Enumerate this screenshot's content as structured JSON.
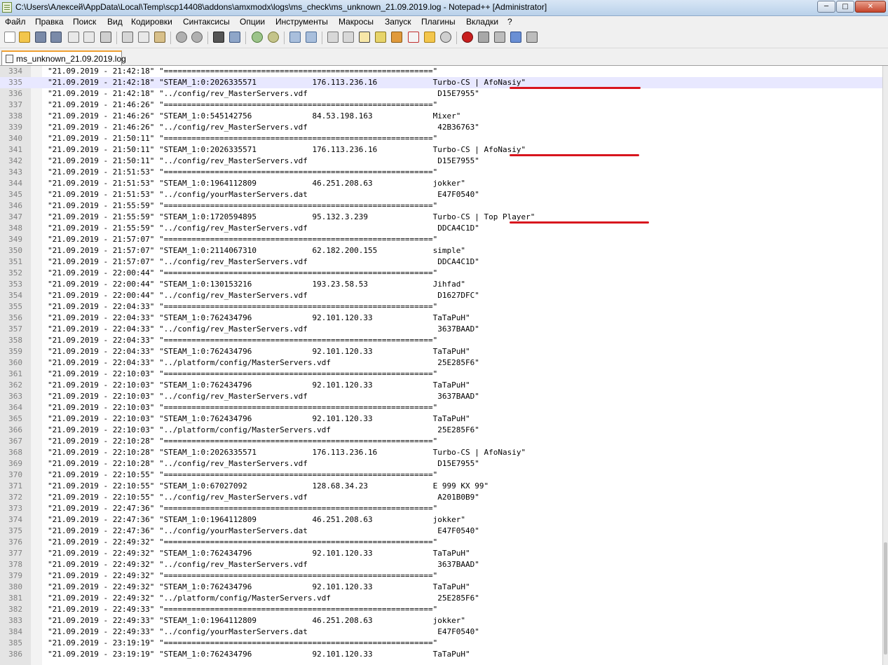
{
  "window": {
    "title": "C:\\Users\\Алексей\\AppData\\Local\\Temp\\scp14408\\addons\\amxmodx\\logs\\ms_check\\ms_unknown_21.09.2019.log - Notepad++ [Administrator]",
    "minimize_symbol": "─",
    "maximize_symbol": "□",
    "close_symbol": "✕"
  },
  "menu": {
    "items": [
      "Файл",
      "Правка",
      "Поиск",
      "Вид",
      "Кодировки",
      "Синтаксисы",
      "Опции",
      "Инструменты",
      "Макросы",
      "Запуск",
      "Плагины",
      "Вкладки",
      "?"
    ]
  },
  "tab": {
    "label": "ms_unknown_21.09.2019.log"
  },
  "editor": {
    "lines": [
      {
        "n": "334",
        "text": "\"21.09.2019 - 21:42:18\" \"==========================================================\""
      },
      {
        "n": "335",
        "text": "\"21.09.2019 - 21:42:18\" \"STEAM_1:0:2026335571            176.113.236.16            Turbo-CS | AfoNasiy\""
      },
      {
        "n": "336",
        "text": "\"21.09.2019 - 21:42:18\" \"../config/rev_MasterServers.vdf                            D15E7955\""
      },
      {
        "n": "337",
        "text": "\"21.09.2019 - 21:46:26\" \"==========================================================\""
      },
      {
        "n": "338",
        "text": "\"21.09.2019 - 21:46:26\" \"STEAM_1:0:545142756             84.53.198.163             Mixer\""
      },
      {
        "n": "339",
        "text": "\"21.09.2019 - 21:46:26\" \"../config/rev_MasterServers.vdf                            42B36763\""
      },
      {
        "n": "340",
        "text": "\"21.09.2019 - 21:50:11\" \"==========================================================\""
      },
      {
        "n": "341",
        "text": "\"21.09.2019 - 21:50:11\" \"STEAM_1:0:2026335571            176.113.236.16            Turbo-CS | AfoNasiy\""
      },
      {
        "n": "342",
        "text": "\"21.09.2019 - 21:50:11\" \"../config/rev_MasterServers.vdf                            D15E7955\""
      },
      {
        "n": "343",
        "text": "\"21.09.2019 - 21:51:53\" \"==========================================================\""
      },
      {
        "n": "344",
        "text": "\"21.09.2019 - 21:51:53\" \"STEAM_1:0:1964112809            46.251.208.63             jokker\""
      },
      {
        "n": "345",
        "text": "\"21.09.2019 - 21:51:53\" \"../config/yourMasterServers.dat                            E47F0540\""
      },
      {
        "n": "346",
        "text": "\"21.09.2019 - 21:55:59\" \"==========================================================\""
      },
      {
        "n": "347",
        "text": "\"21.09.2019 - 21:55:59\" \"STEAM_1:0:1720594895            95.132.3.239              Turbo-CS | Top Player\""
      },
      {
        "n": "348",
        "text": "\"21.09.2019 - 21:55:59\" \"../config/rev_MasterServers.vdf                            DDCA4C1D\""
      },
      {
        "n": "349",
        "text": "\"21.09.2019 - 21:57:07\" \"==========================================================\""
      },
      {
        "n": "350",
        "text": "\"21.09.2019 - 21:57:07\" \"STEAM_1:0:2114067310            62.182.200.155            simple\""
      },
      {
        "n": "351",
        "text": "\"21.09.2019 - 21:57:07\" \"../config/rev_MasterServers.vdf                            DDCA4C1D\""
      },
      {
        "n": "352",
        "text": "\"21.09.2019 - 22:00:44\" \"==========================================================\""
      },
      {
        "n": "353",
        "text": "\"21.09.2019 - 22:00:44\" \"STEAM_1:0:130153216             193.23.58.53              Jihfad\""
      },
      {
        "n": "354",
        "text": "\"21.09.2019 - 22:00:44\" \"../config/rev_MasterServers.vdf                            D1627DFC\""
      },
      {
        "n": "355",
        "text": "\"21.09.2019 - 22:04:33\" \"==========================================================\""
      },
      {
        "n": "356",
        "text": "\"21.09.2019 - 22:04:33\" \"STEAM_1:0:762434796             92.101.120.33             TaTaPuH\""
      },
      {
        "n": "357",
        "text": "\"21.09.2019 - 22:04:33\" \"../config/rev_MasterServers.vdf                            3637BAAD\""
      },
      {
        "n": "358",
        "text": "\"21.09.2019 - 22:04:33\" \"==========================================================\""
      },
      {
        "n": "359",
        "text": "\"21.09.2019 - 22:04:33\" \"STEAM_1:0:762434796             92.101.120.33             TaTaPuH\""
      },
      {
        "n": "360",
        "text": "\"21.09.2019 - 22:04:33\" \"../platform/config/MasterServers.vdf                       25E285F6\""
      },
      {
        "n": "361",
        "text": "\"21.09.2019 - 22:10:03\" \"==========================================================\""
      },
      {
        "n": "362",
        "text": "\"21.09.2019 - 22:10:03\" \"STEAM_1:0:762434796             92.101.120.33             TaTaPuH\""
      },
      {
        "n": "363",
        "text": "\"21.09.2019 - 22:10:03\" \"../config/rev_MasterServers.vdf                            3637BAAD\""
      },
      {
        "n": "364",
        "text": "\"21.09.2019 - 22:10:03\" \"==========================================================\""
      },
      {
        "n": "365",
        "text": "\"21.09.2019 - 22:10:03\" \"STEAM_1:0:762434796             92.101.120.33             TaTaPuH\""
      },
      {
        "n": "366",
        "text": "\"21.09.2019 - 22:10:03\" \"../platform/config/MasterServers.vdf                       25E285F6\""
      },
      {
        "n": "367",
        "text": "\"21.09.2019 - 22:10:28\" \"==========================================================\""
      },
      {
        "n": "368",
        "text": "\"21.09.2019 - 22:10:28\" \"STEAM_1:0:2026335571            176.113.236.16            Turbo-CS | AfoNasiy\""
      },
      {
        "n": "369",
        "text": "\"21.09.2019 - 22:10:28\" \"../config/rev_MasterServers.vdf                            D15E7955\""
      },
      {
        "n": "370",
        "text": "\"21.09.2019 - 22:10:55\" \"==========================================================\""
      },
      {
        "n": "371",
        "text": "\"21.09.2019 - 22:10:55\" \"STEAM_1:0:67027092              128.68.34.23              E 999 KX 99\""
      },
      {
        "n": "372",
        "text": "\"21.09.2019 - 22:10:55\" \"../config/rev_MasterServers.vdf                            A201B0B9\""
      },
      {
        "n": "373",
        "text": "\"21.09.2019 - 22:47:36\" \"==========================================================\""
      },
      {
        "n": "374",
        "text": "\"21.09.2019 - 22:47:36\" \"STEAM_1:0:1964112809            46.251.208.63             jokker\""
      },
      {
        "n": "375",
        "text": "\"21.09.2019 - 22:47:36\" \"../config/yourMasterServers.dat                            E47F0540\""
      },
      {
        "n": "376",
        "text": "\"21.09.2019 - 22:49:32\" \"==========================================================\""
      },
      {
        "n": "377",
        "text": "\"21.09.2019 - 22:49:32\" \"STEAM_1:0:762434796             92.101.120.33             TaTaPuH\""
      },
      {
        "n": "378",
        "text": "\"21.09.2019 - 22:49:32\" \"../config/rev_MasterServers.vdf                            3637BAAD\""
      },
      {
        "n": "379",
        "text": "\"21.09.2019 - 22:49:32\" \"==========================================================\""
      },
      {
        "n": "380",
        "text": "\"21.09.2019 - 22:49:32\" \"STEAM_1:0:762434796             92.101.120.33             TaTaPuH\""
      },
      {
        "n": "381",
        "text": "\"21.09.2019 - 22:49:32\" \"../platform/config/MasterServers.vdf                       25E285F6\""
      },
      {
        "n": "382",
        "text": "\"21.09.2019 - 22:49:33\" \"==========================================================\""
      },
      {
        "n": "383",
        "text": "\"21.09.2019 - 22:49:33\" \"STEAM_1:0:1964112809            46.251.208.63             jokker\""
      },
      {
        "n": "384",
        "text": "\"21.09.2019 - 22:49:33\" \"../config/yourMasterServers.dat                            E47F0540\""
      },
      {
        "n": "385",
        "text": "\"21.09.2019 - 23:19:19\" \"==========================================================\""
      },
      {
        "n": "386",
        "text": "\"21.09.2019 - 23:19:19\" \"STEAM_1:0:762434796             92.101.120.33             TaTaPuH\""
      }
    ]
  }
}
